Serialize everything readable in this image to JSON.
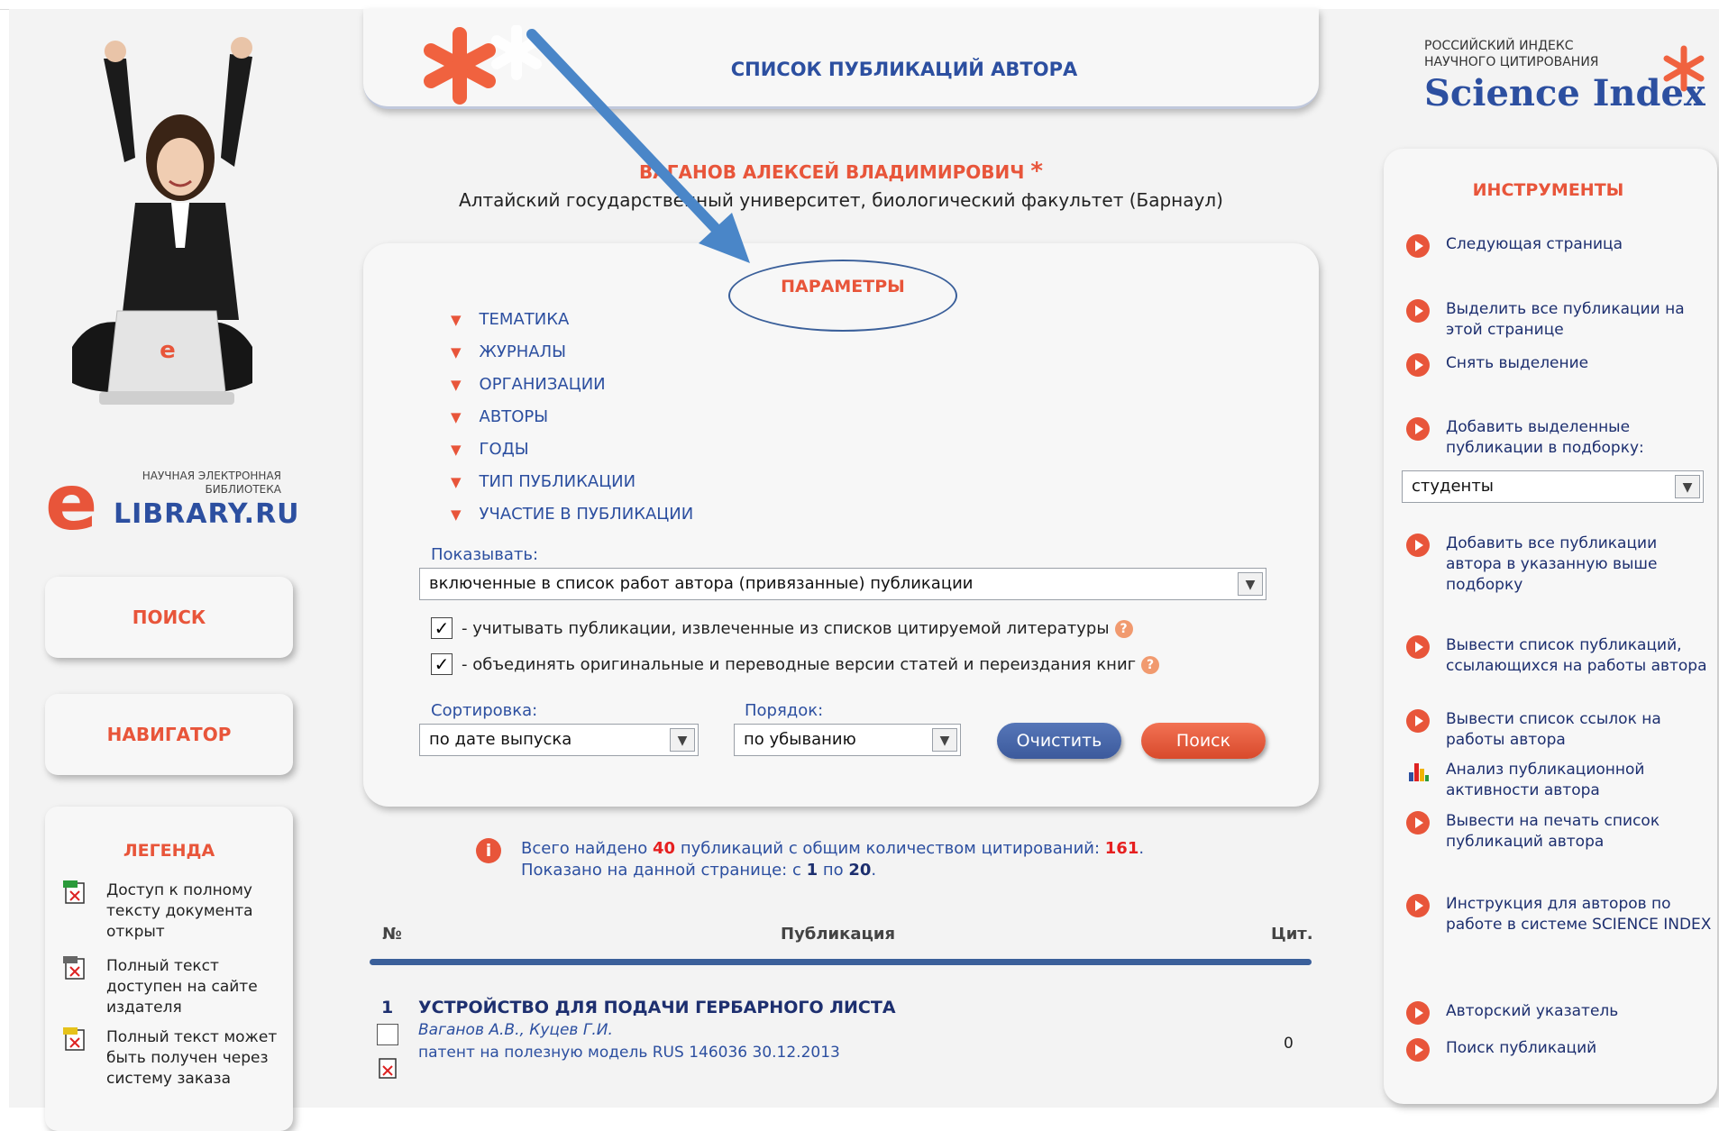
{
  "header": {
    "title": "СПИСОК ПУБЛИКАЦИЙ АВТОРА"
  },
  "author": {
    "name": "ВАГАНОВ АЛЕКСЕЙ ВЛАДИМИРОВИЧ",
    "affiliation": "Алтайский государственный университет, биологический факультет (Барнаул)"
  },
  "logo": {
    "top_line1": "НАУЧНАЯ ЭЛЕКТРОННАЯ",
    "top_line2": "БИБЛИОТЕКА",
    "brand": "LIBRARY.RU",
    "letter": "e"
  },
  "left_nav": {
    "search": "ПОИСК",
    "navigator": "НАВИГАТОР"
  },
  "legend": {
    "title": "ЛЕГЕНДА",
    "items": [
      {
        "text": "Доступ к полному тексту документа открыт",
        "icon": "pdf-open-icon"
      },
      {
        "text": "Полный текст доступен на сайте издателя",
        "icon": "pdf-publisher-icon"
      },
      {
        "text": "Полный текст может быть получен через систему заказа",
        "icon": "pdf-order-icon"
      }
    ]
  },
  "params": {
    "title": "ПАРАМЕТРЫ",
    "filters": [
      "ТЕМАТИКА",
      "ЖУРНАЛЫ",
      "ОРГАНИЗАЦИИ",
      "АВТОРЫ",
      "ГОДЫ",
      "ТИП ПУБЛИКАЦИИ",
      "УЧАСТИЕ В ПУБЛИКАЦИИ"
    ],
    "show_label": "Показывать:",
    "show_value": "включенные в список работ автора (привязанные) публикации",
    "check1": "- учитывать публикации, извлеченные из списков цитируемой литературы",
    "check2": "- объединять оригинальные и переводные версии статей и переиздания книг",
    "sort_label": "Сортировка:",
    "sort_value": "по дате выпуска",
    "order_label": "Порядок:",
    "order_value": "по убыванию",
    "clear_btn": "Очистить",
    "search_btn": "Поиск"
  },
  "summary": {
    "line1_pre": "Всего найдено ",
    "found": "40",
    "line1_mid": " публикаций с общим количеством цитирований: ",
    "citations": "161",
    "line1_end": ".",
    "line2_pre": "Показано на данной странице: с ",
    "from": "1",
    "line2_mid": " по ",
    "to": "20",
    "line2_end": "."
  },
  "table": {
    "col_num": "№",
    "col_pub": "Публикация",
    "col_cit": "Цит.",
    "rows": [
      {
        "num": "1",
        "title": "УСТРОЙСТВО ДЛЯ ПОДАЧИ ГЕРБАРНОГО ЛИСТА",
        "authors": "Ваганов А.В., Куцев Г.И.",
        "source": "патент на полезную модель RUS 146036 30.12.2013",
        "cit": "0"
      }
    ]
  },
  "science_index": {
    "line1": "РОССИЙСКИЙ ИНДЕКС",
    "line2": "НАУЧНОГО ЦИТИРОВАНИЯ",
    "brand": "Science Index"
  },
  "tools": {
    "title": "ИНСТРУМЕНТЫ",
    "next_page": "Следующая страница",
    "select_all": "Выделить все публикации на этой странице",
    "deselect": "Снять выделение",
    "add_selected": "Добавить выделенные публикации в подборку:",
    "collection_value": "студенты",
    "add_all": "Добавить все публикации автора в указанную выше подборку",
    "citing_list": "Вывести список публикаций, ссылающихся на работы автора",
    "refs_list": "Вывести список ссылок на работы автора",
    "analysis": "Анализ публикационной активности автора",
    "print_list": "Вывести на печать список публикаций автора",
    "instructions": "Инструкция для авторов по работе в системе SCIENCE INDEX",
    "author_index": "Авторский указатель",
    "pub_search": "Поиск публикаций"
  },
  "colors": {
    "accent": "#e8553a",
    "brand_blue": "#2c4fa0",
    "arrow": "#4a86c8"
  }
}
